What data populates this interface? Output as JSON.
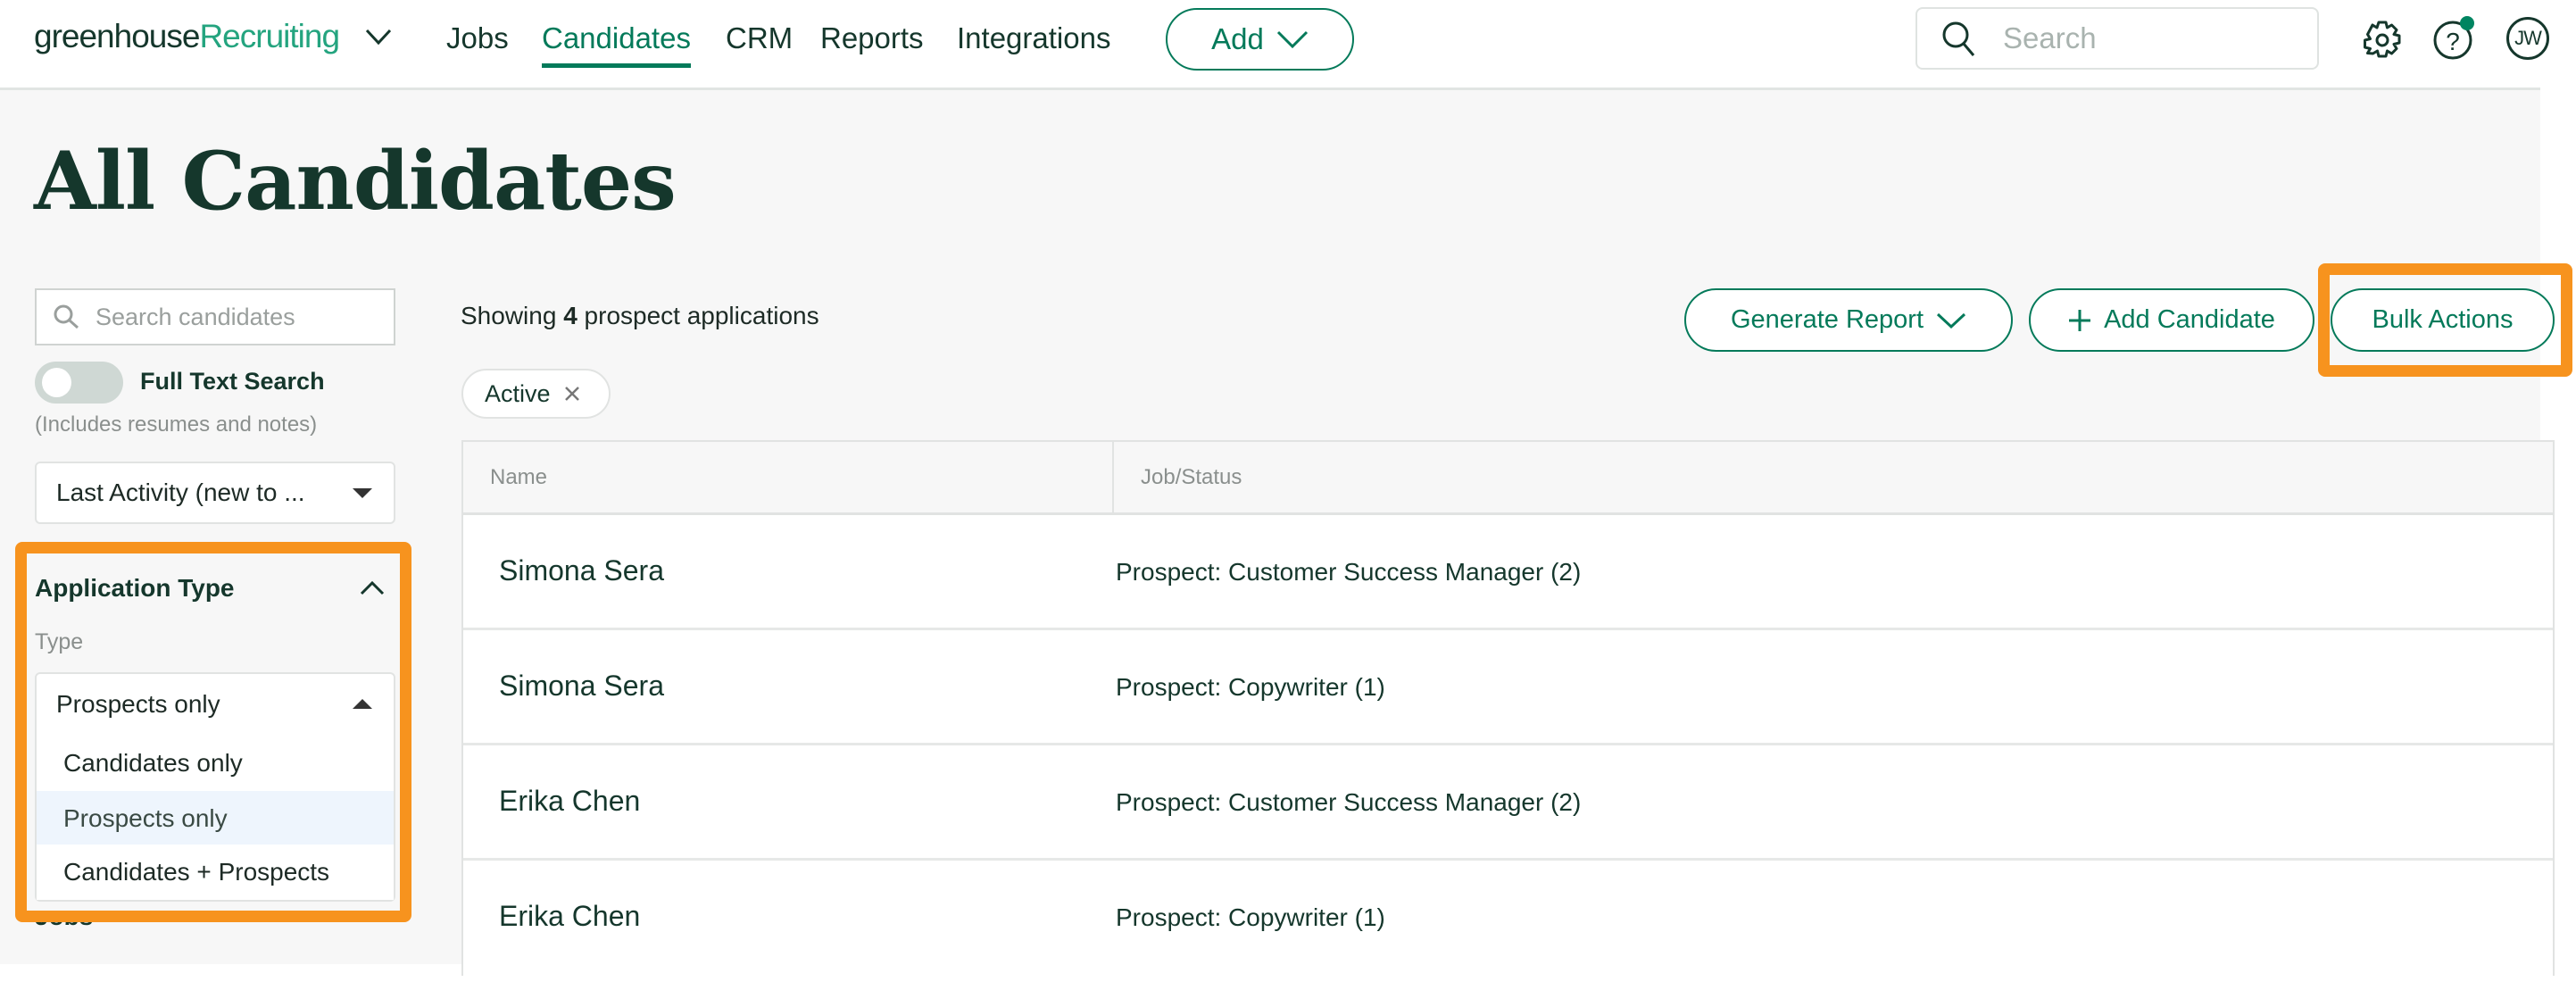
{
  "nav": {
    "logo_main": "greenhouse",
    "logo_product": "Recruiting",
    "items": [
      {
        "label": "Jobs",
        "active": false
      },
      {
        "label": "Candidates",
        "active": true
      },
      {
        "label": "CRM",
        "active": false
      },
      {
        "label": "Reports",
        "active": false
      },
      {
        "label": "Integrations",
        "active": false
      }
    ],
    "add_label": "Add",
    "search_placeholder": "Search",
    "avatar_initials": "JW",
    "help_notification_color": "#008561"
  },
  "page_title": "All Candidates",
  "sidebar": {
    "search_placeholder": "Search candidates",
    "full_text_label": "Full Text Search",
    "full_text_enabled": false,
    "full_text_note": "(Includes resumes and notes)",
    "sort_value": "Last Activity (new to ...",
    "application_type": {
      "heading": "Application Type",
      "type_label": "Type",
      "selected": "Prospects only",
      "options": [
        "Candidates only",
        "Prospects only",
        "Candidates + Prospects"
      ]
    },
    "next_section": "Jobs"
  },
  "main": {
    "showing_prefix": "Showing ",
    "showing_count": "4",
    "showing_suffix": " prospect applications",
    "buttons": {
      "generate_report": "Generate Report",
      "add_candidate": "Add Candidate",
      "bulk_actions": "Bulk Actions"
    },
    "filter_chip": "Active",
    "columns": [
      "Name",
      "Job/Status"
    ],
    "rows": [
      {
        "name": "Simona Sera",
        "job": "Prospect: Customer Success Manager (2)"
      },
      {
        "name": "Simona Sera",
        "job": "Prospect: Copywriter (1)"
      },
      {
        "name": "Erika Chen",
        "job": "Prospect: Customer Success Manager (2)"
      },
      {
        "name": "Erika Chen",
        "job": "Prospect: Copywriter (1)"
      }
    ]
  },
  "colors": {
    "brand_green": "#047a5a",
    "logo_green": "#24a47f",
    "highlight_orange": "#f7931e",
    "text_dark": "#15372c"
  }
}
